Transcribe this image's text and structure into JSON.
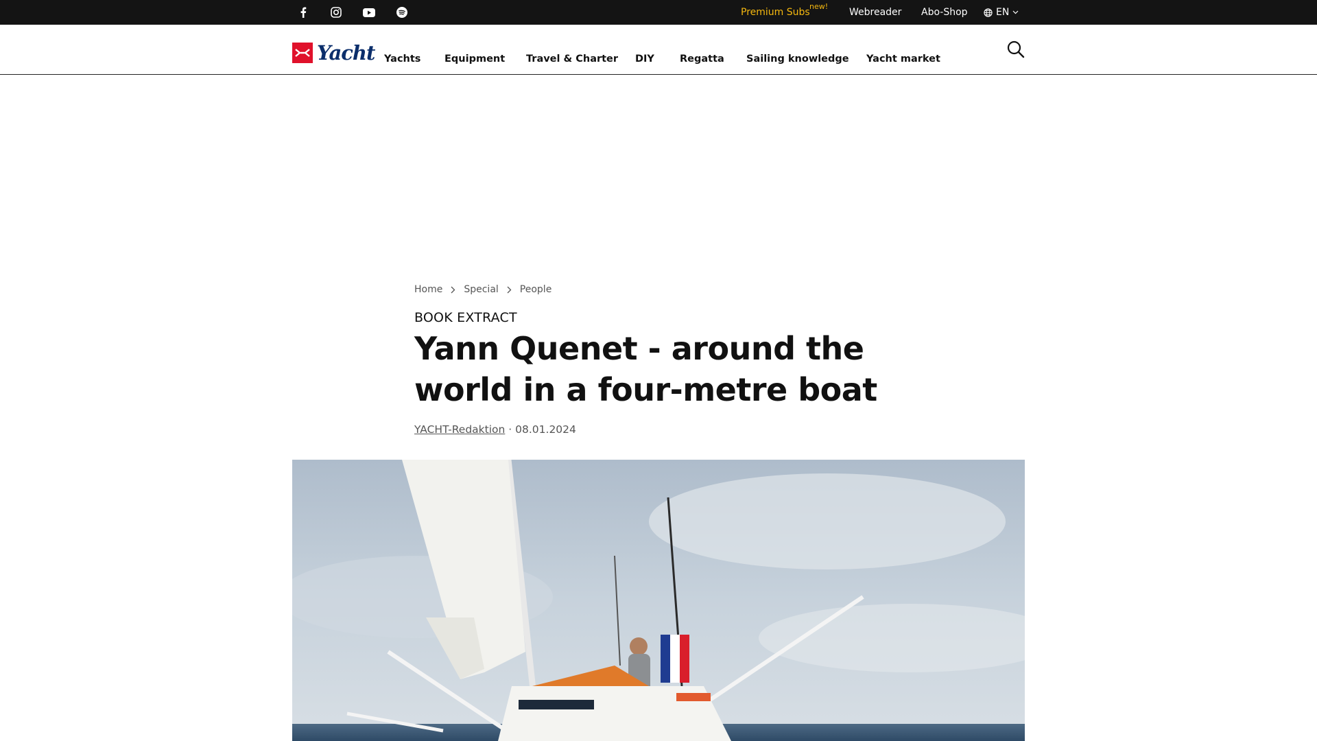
{
  "topbar": {
    "social": [
      {
        "icon": "facebook-icon"
      },
      {
        "icon": "instagram-icon"
      },
      {
        "icon": "youtube-icon"
      },
      {
        "icon": "spotify-icon"
      }
    ],
    "premium_label": "Premium Subs",
    "premium_badge": "new!",
    "webreader_label": "Webreader",
    "aboshop_label": "Abo-Shop",
    "language": "EN",
    "accent_color": "#f5b80f"
  },
  "header": {
    "logo_text": "Yacht",
    "brand_color": "#e0112b",
    "nav": [
      "Yachts",
      "Equipment",
      "Travel & Charter",
      "DIY",
      "Regatta",
      "Sailing knowledge",
      "Yacht market"
    ]
  },
  "breadcrumb": [
    "Home",
    "Special",
    "People"
  ],
  "article": {
    "kicker": "BOOK EXTRACT",
    "title": "Yann Quenet - around the world in a four-metre boat",
    "author": "YACHT-Redaktion",
    "separator": "·",
    "date": "08.01.2024"
  }
}
